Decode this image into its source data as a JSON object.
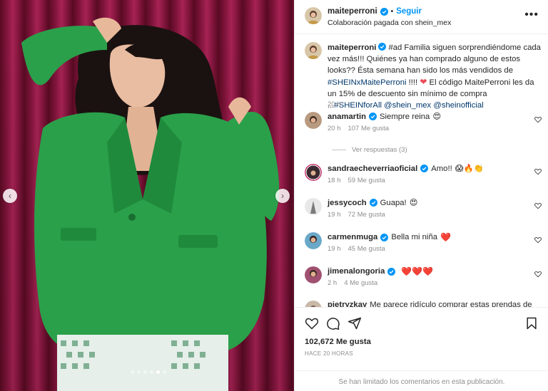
{
  "post": {
    "slide_count": 6,
    "active_slide": 4
  },
  "header": {
    "username": "maiteperroni",
    "follow_label": "Seguir",
    "subtitle": "Colaboración pagada con shein_mex",
    "more_icon": "more-icon"
  },
  "caption": {
    "username": "maiteperroni",
    "text_part1": "#ad Familia siguen sorprendiéndome cada vez más!!! Quiénes ya han comprado alguno de estos looks?? Ésta semana han sido los más vendidos de ",
    "hashtag1": "#SHEINxMaitePerroni",
    "text_part2": " !!!! ",
    "text_part3": " El código MaitePerroni les da un 15% de descuento sin mínimo de compra ...",
    "hashtag2": "#SHEINforAll",
    "mention1": "@shein_mex",
    "mention2": "@sheinofficial",
    "time": "20 h"
  },
  "comments": [
    {
      "username": "anamartin",
      "text": "Siempre reina",
      "emoji": "😍",
      "time": "20 h",
      "likes": "107 Me gusta"
    },
    {
      "username": "sandraecheverriaoficial",
      "text": "Amo!!",
      "emoji": "😱🔥👏",
      "time": "18 h",
      "likes": "59 Me gusta"
    },
    {
      "username": "jessycoch",
      "text": "Guapa!",
      "emoji": "😍",
      "time": "19 h",
      "likes": "72 Me gusta"
    },
    {
      "username": "carmenmuga",
      "text": "Bella mi niña",
      "emoji": "❤️",
      "time": "19 h",
      "likes": "45 Me gusta"
    },
    {
      "username": "jimenalongoria",
      "text": "",
      "emoji": "❤️❤️❤️",
      "time": "2 h",
      "likes": "4 Me gusta"
    },
    {
      "username": "pietryzkay",
      "text": "Me parece ridículo comprar estas prendas de",
      "emoji": "",
      "time": "",
      "likes": ""
    }
  ],
  "replies_label": "Ver respuestas (3)",
  "actions": {
    "likes_count": "102,672 Me gusta",
    "posted_ago": "HACE 20 HORAS",
    "comments_limited": "Se han limitado los comentarios en esta publicación."
  },
  "colors": {
    "accent": "#0095f6",
    "curtain": "#8a1640",
    "jacket": "#2aa04a",
    "heart": "#ed4956"
  }
}
